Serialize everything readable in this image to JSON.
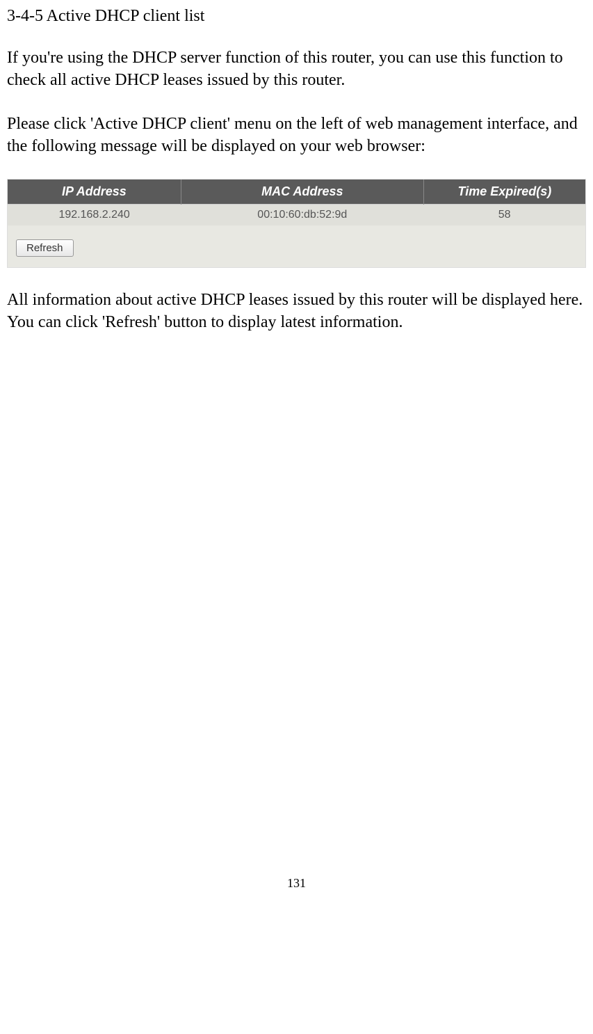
{
  "heading": "3-4-5 Active DHCP client list",
  "para1": "If you're using the DHCP server function of this router, you can use this function to check all active DHCP leases issued by this router.",
  "para2": "Please click 'Active DHCP client' menu on the left of web management interface, and the following message will be displayed on your web browser:",
  "table": {
    "headers": {
      "ip": "IP Address",
      "mac": "MAC Address",
      "time": "Time Expired(s)"
    },
    "row": {
      "ip": "192.168.2.240",
      "mac": "00:10:60:db:52:9d",
      "time": "58"
    }
  },
  "refresh_label": "Refresh",
  "para3": "All information about active DHCP leases issued by this router will be displayed here. You can click 'Refresh' button to display latest information.",
  "page_number": "131"
}
